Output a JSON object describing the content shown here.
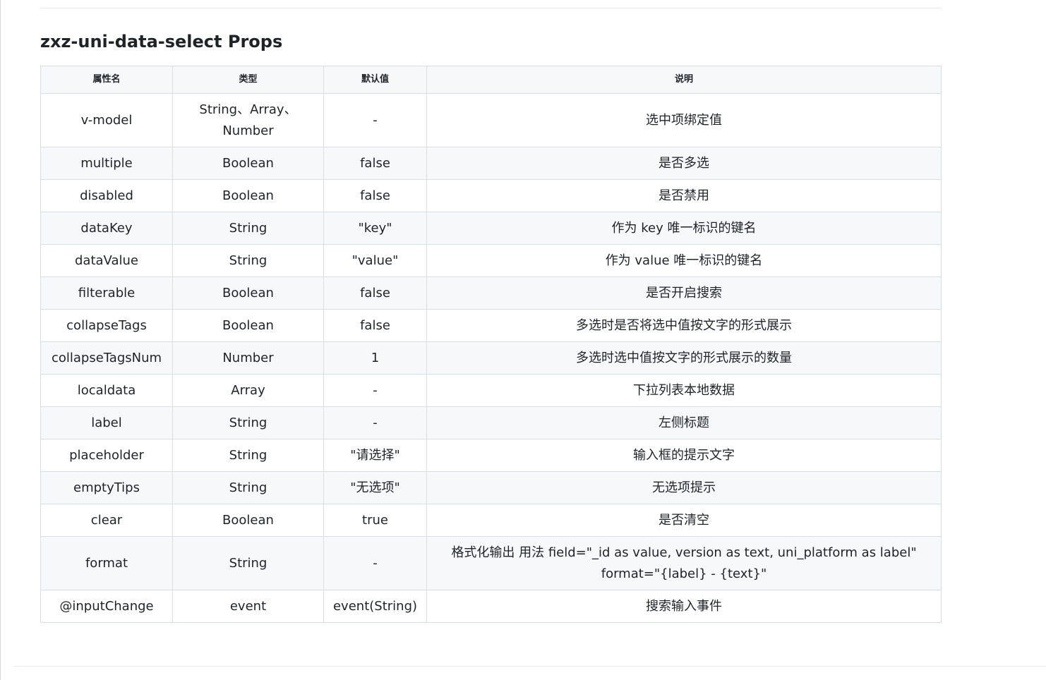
{
  "section": {
    "title": "zxz-uni-data-select Props"
  },
  "table": {
    "headers": [
      "属性名",
      "类型",
      "默认值",
      "说明"
    ],
    "rows": [
      {
        "name": "v-model",
        "type": "String、Array、Number",
        "default": "-",
        "desc": "选中项绑定值"
      },
      {
        "name": "multiple",
        "type": "Boolean",
        "default": "false",
        "desc": "是否多选"
      },
      {
        "name": "disabled",
        "type": "Boolean",
        "default": "false",
        "desc": "是否禁用"
      },
      {
        "name": "dataKey",
        "type": "String",
        "default": "\"key\"",
        "desc": "作为 key 唯一标识的键名"
      },
      {
        "name": "dataValue",
        "type": "String",
        "default": "\"value\"",
        "desc": "作为 value 唯一标识的键名"
      },
      {
        "name": "filterable",
        "type": "Boolean",
        "default": "false",
        "desc": "是否开启搜索"
      },
      {
        "name": "collapseTags",
        "type": "Boolean",
        "default": "false",
        "desc": "多选时是否将选中值按文字的形式展示"
      },
      {
        "name": "collapseTagsNum",
        "type": "Number",
        "default": "1",
        "desc": "多选时选中值按文字的形式展示的数量"
      },
      {
        "name": "localdata",
        "type": "Array",
        "default": "-",
        "desc": "下拉列表本地数据"
      },
      {
        "name": "label",
        "type": "String",
        "default": "-",
        "desc": "左侧标题"
      },
      {
        "name": "placeholder",
        "type": "String",
        "default": "\"请选择\"",
        "desc": "输入框的提示文字"
      },
      {
        "name": "emptyTips",
        "type": "String",
        "default": "\"无选项\"",
        "desc": "无选项提示"
      },
      {
        "name": "clear",
        "type": "Boolean",
        "default": "true",
        "desc": "是否清空"
      },
      {
        "name": "format",
        "type": "String",
        "default": "-",
        "desc": "格式化输出 用法 field=\"_id as value, version as text, uni_platform as label\" format=\"{label} - {text}\""
      },
      {
        "name": "@inputChange",
        "type": "event",
        "default": "event(String)",
        "desc": "搜索输入事件"
      }
    ]
  }
}
